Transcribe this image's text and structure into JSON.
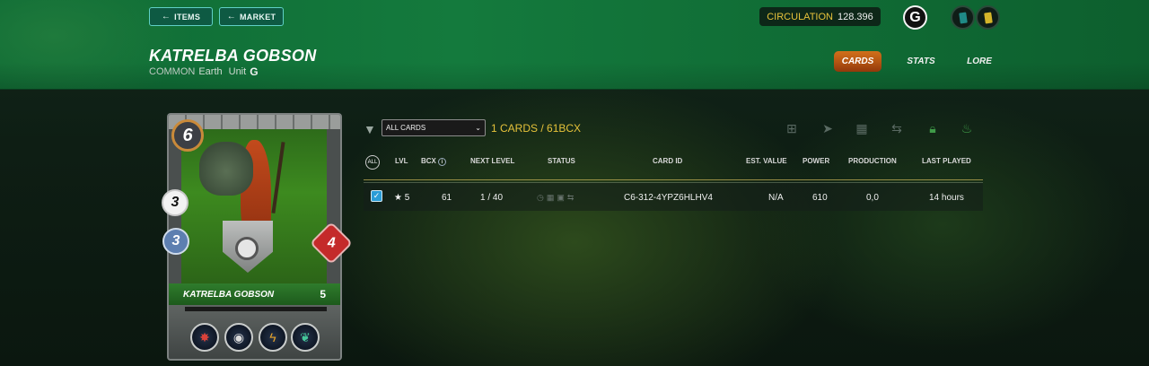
{
  "nav": {
    "items_label": "ITEMS",
    "market_label": "MARKET"
  },
  "header": {
    "circulation_label": "CIRCULATION",
    "circulation_value": "128.396",
    "g_label": "G"
  },
  "card": {
    "name": "KATRELBA GOBSON",
    "rarity": "COMMON",
    "element": "Earth",
    "type": "Unit",
    "edition_icon": "G",
    "mana": "6",
    "attack": "3",
    "speed": "3",
    "health": "4",
    "level": "5",
    "abilities": [
      "blast-ability-icon",
      "shield-ability-icon",
      "lightning-ability-icon",
      "nature-ability-icon"
    ]
  },
  "tabs": {
    "cards": "CARDS",
    "stats": "STATS",
    "lore": "LORE"
  },
  "filter": {
    "select_value": "ALL CARDS",
    "count_text": "1 CARDS / 61BCX"
  },
  "table": {
    "headers": {
      "all": "ALL",
      "lvl": "LVL",
      "bcx": "BCX",
      "next_level": "NEXT LEVEL",
      "status": "STATUS",
      "card_id": "CARD ID",
      "est_value": "EST. VALUE",
      "power": "POWER",
      "production": "PRODUCTION",
      "last_played": "LAST PLAYED"
    },
    "rows": [
      {
        "lvl": "★ 5",
        "bcx": "61",
        "next_level": "1 / 40",
        "card_id": "C6-312-4YPZ6HLHV4",
        "est_value": "N/A",
        "power": "610",
        "production": "0,0",
        "last_played": "14 hours"
      }
    ]
  }
}
